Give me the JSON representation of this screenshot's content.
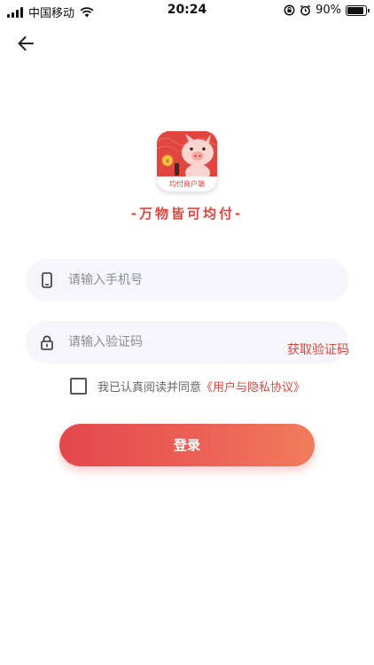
{
  "status_bar": {
    "carrier": "中国移动",
    "time": "20:24",
    "battery": "90%",
    "battery_level": 0.9
  },
  "logo": {
    "caption": "均付商户端"
  },
  "slogan": "-万物皆可均付-",
  "phone_input": {
    "placeholder": "请输入手机号",
    "value": ""
  },
  "code_input": {
    "placeholder": "请输入验证码",
    "value": ""
  },
  "get_code_label": "获取验证码",
  "agreement": {
    "text": "我已认真阅读并同意",
    "link": "《用户与隐私协议》",
    "checked": false
  },
  "login_label": "登录",
  "colors": {
    "accent": "#e0463f",
    "field_bg": "#f5f5fb",
    "button_start": "#e4474c",
    "button_end": "#f07c5c"
  }
}
